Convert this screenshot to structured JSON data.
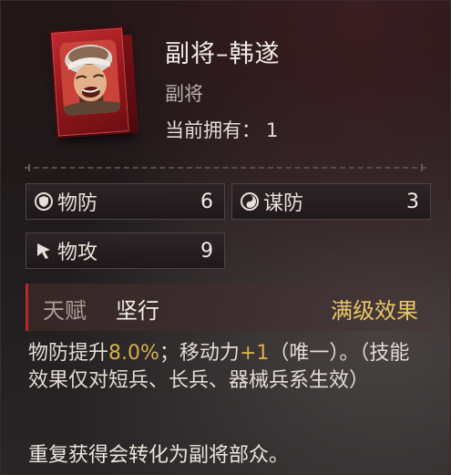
{
  "header": {
    "title": "副将–韩遂",
    "subtitle": "副将",
    "owned_label": "当前拥有：",
    "owned_count": "1"
  },
  "stats": {
    "phys_def": {
      "label": "物防",
      "value": "6",
      "icon": "shield-icon"
    },
    "strat_def": {
      "label": "谋防",
      "value": "3",
      "icon": "yin-yang-icon"
    },
    "phys_atk": {
      "label": "物攻",
      "value": "9",
      "icon": "cursor-arrow-icon"
    }
  },
  "talent": {
    "label": "天赋",
    "name": "坚行",
    "max_effect": "满级效果"
  },
  "description": {
    "part1": "物防提升",
    "pct": "8.0%",
    "part2": "；移动力",
    "plus": "+1",
    "part3": "（唯一）。（技能效果仅对短兵、长兵、器械兵系生效）"
  },
  "footer": "重复获得会转化为副将部众。",
  "colors": {
    "accent_red": "#b52a2d",
    "highlight_gold": "#d8ae4e",
    "max_effect_gold": "#e8c76a"
  }
}
